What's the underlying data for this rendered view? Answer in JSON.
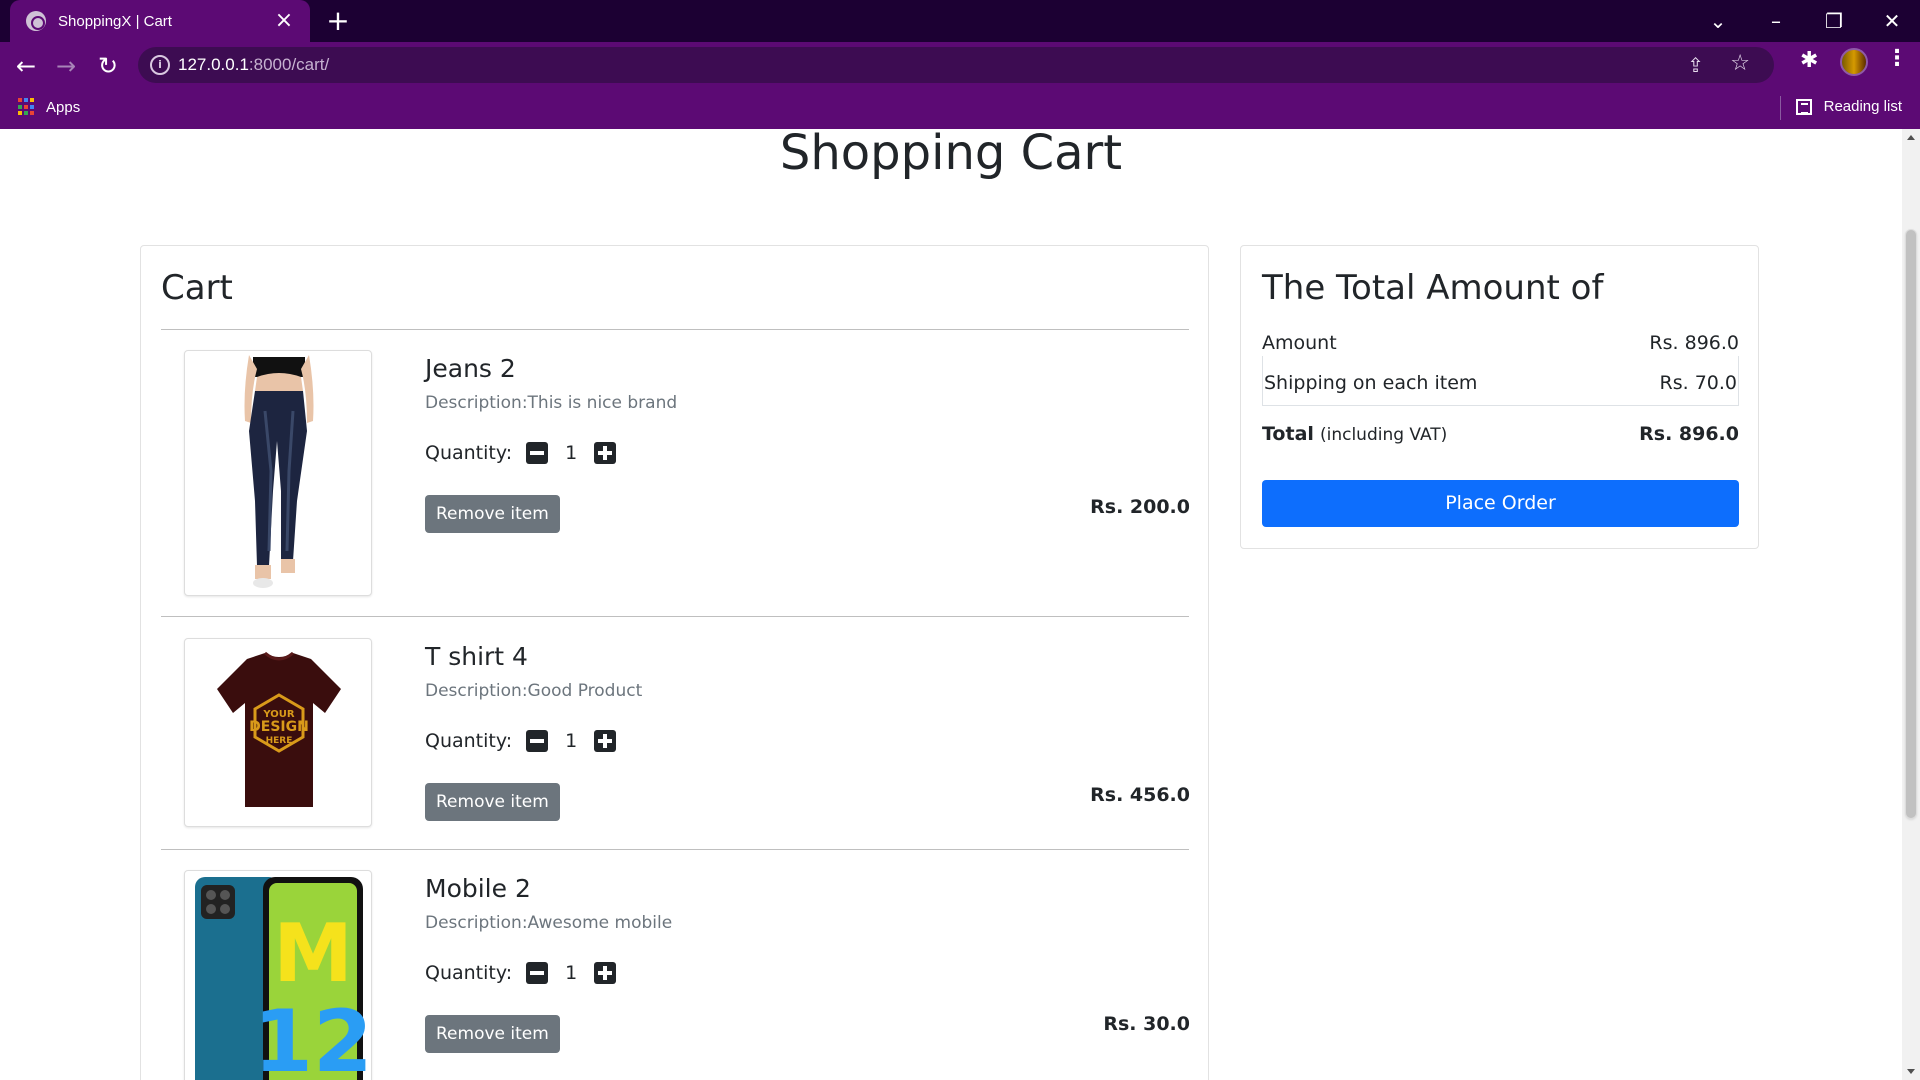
{
  "browser": {
    "tab_title": "ShoppingX | Cart",
    "url_host": "127.0.0.1",
    "url_path": ":8000/cart/",
    "bookmarks_apps": "Apps",
    "reading_list": "Reading list"
  },
  "page": {
    "title": "Shopping Cart"
  },
  "cart": {
    "heading": "Cart",
    "quantity_label": "Quantity:",
    "remove_label": "Remove item",
    "items": [
      {
        "name": "Jeans 2",
        "description": "Description:This is nice brand",
        "quantity": "1",
        "price": "Rs. 200.0"
      },
      {
        "name": "T shirt 4",
        "description": "Description:Good Product",
        "quantity": "1",
        "price": "Rs. 456.0"
      },
      {
        "name": "Mobile 2",
        "description": "Description:Awesome mobile",
        "quantity": "1",
        "price": "Rs. 30.0"
      }
    ]
  },
  "summary": {
    "heading": "The Total Amount of",
    "amount_label": "Amount",
    "amount_value": "Rs. 896.0",
    "shipping_label": "Shipping on each item",
    "shipping_value": "Rs. 70.0",
    "total_label": "Total",
    "total_sub": "(including VAT)",
    "total_value": "Rs. 896.0",
    "place_order": "Place Order"
  },
  "colors": {
    "browser_frame": "#5c0a74",
    "tabstrip": "#1c0033",
    "primary_button": "#0d6efd",
    "secondary_button": "#6c757d"
  }
}
